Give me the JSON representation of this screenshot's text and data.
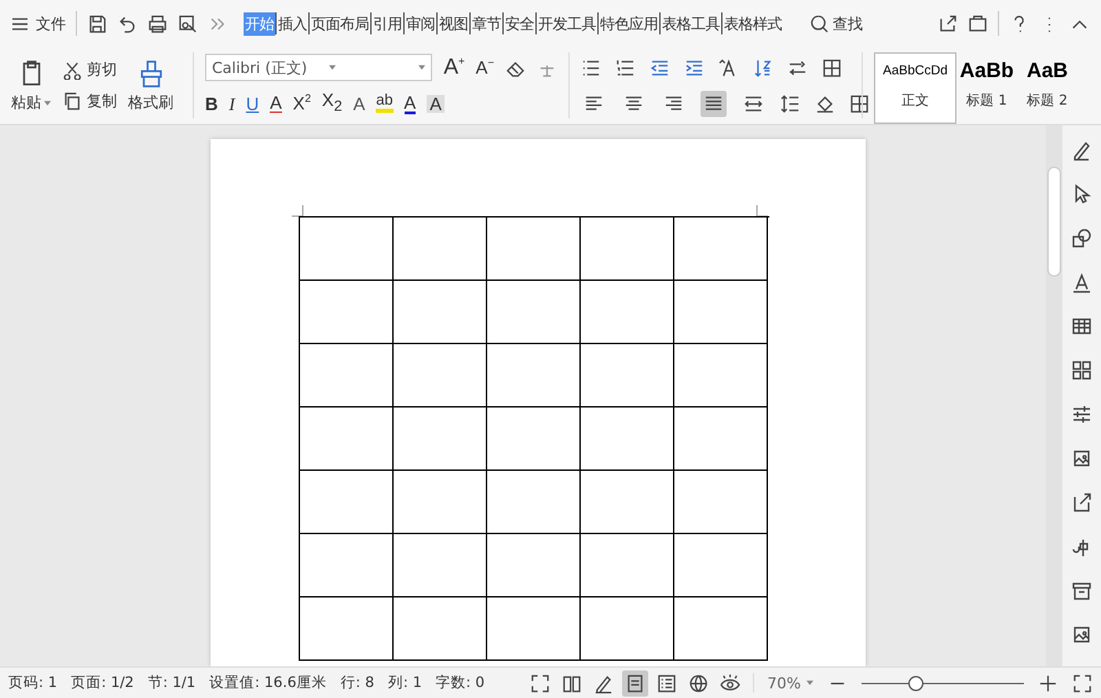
{
  "menu": {
    "file_label": "文件",
    "search_label": "查找",
    "tabs": [
      {
        "label": "开始",
        "selected": true
      },
      {
        "label": "插入",
        "selected": false
      },
      {
        "label": "页面布局",
        "selected": false
      },
      {
        "label": "引用",
        "selected": false
      },
      {
        "label": "审阅",
        "selected": false
      },
      {
        "label": "视图",
        "selected": false
      },
      {
        "label": "章节",
        "selected": false
      },
      {
        "label": "安全",
        "selected": false
      },
      {
        "label": "开发工具",
        "selected": false
      },
      {
        "label": "特色应用",
        "selected": false
      },
      {
        "label": "表格工具",
        "selected": false
      },
      {
        "label": "表格样式",
        "selected": false
      }
    ]
  },
  "clipboard": {
    "paste": "粘贴",
    "cut": "剪切",
    "copy": "复制",
    "format_painter": "格式刷"
  },
  "font": {
    "name": "Calibri (正文)",
    "grow": "A$^{+}$",
    "shrink": "A$^{−}$",
    "buttons": [
      {
        "kind": "bold",
        "label": "B"
      },
      {
        "kind": "italic",
        "label": "I"
      },
      {
        "kind": "underline",
        "label": "U"
      },
      {
        "kind": "strike",
        "label": "A"
      },
      {
        "kind": "super",
        "label": "X$^{2}$"
      },
      {
        "kind": "sub",
        "label": "X$_{2}$"
      },
      {
        "kind": "effect",
        "label": "A"
      },
      {
        "kind": "highlight",
        "label": "ab"
      },
      {
        "kind": "color",
        "label": "A"
      },
      {
        "kind": "shade",
        "label": "A"
      }
    ]
  },
  "paragraph": {
    "align": [
      {
        "kind": "left",
        "selected": false
      },
      {
        "kind": "center",
        "selected": false
      },
      {
        "kind": "right",
        "selected": false
      },
      {
        "kind": "justify",
        "selected": true
      },
      {
        "kind": "distributed",
        "selected": false
      }
    ]
  },
  "styles": [
    {
      "preview": "AaBbCcDd",
      "label": "正文",
      "selected": true
    },
    {
      "preview": "AaBb",
      "label": "标题 1",
      "selected": false
    },
    {
      "preview": "AaB",
      "label": "标题 2",
      "selected": false
    }
  ],
  "status_bar": {
    "items": [
      "页码: 1",
      "页面: 1/2",
      "节: 1/1",
      "设置值: 16.6厘米",
      "行: 8",
      "列: 1",
      "字数: 0"
    ],
    "views": [
      {
        "kind": "fullscreen",
        "selected": false
      },
      {
        "kind": "reading",
        "selected": false
      },
      {
        "kind": "edit",
        "selected": false
      },
      {
        "kind": "page",
        "selected": true
      },
      {
        "kind": "outline",
        "selected": false
      },
      {
        "kind": "web",
        "selected": false
      },
      {
        "kind": "eye",
        "selected": false
      }
    ],
    "zoom": "70%",
    "zoom_slider": {
      "level": 0.33
    }
  }
}
